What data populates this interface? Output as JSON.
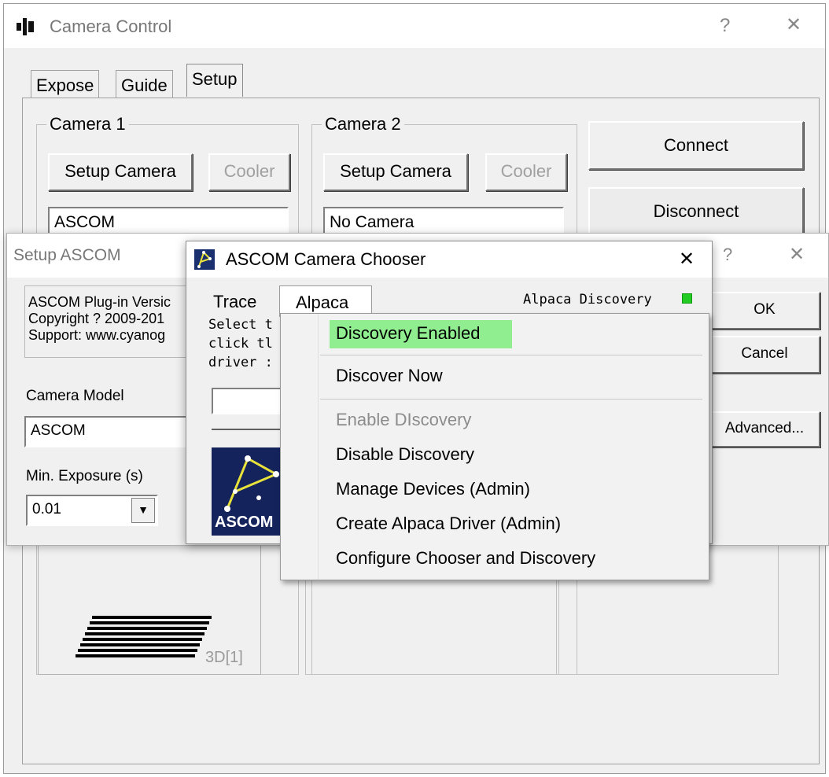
{
  "main_window": {
    "title": "Camera Control",
    "help": "?",
    "close": "✕",
    "tabs": [
      "Expose",
      "Guide",
      "Setup"
    ],
    "camera1": {
      "legend": "Camera 1",
      "setup_label": "Setup Camera",
      "cooler_label": "Cooler",
      "value": "ASCOM"
    },
    "camera2": {
      "legend": "Camera 2",
      "setup_label": "Setup Camera",
      "cooler_label": "Cooler",
      "value": "No Camera"
    },
    "connect_label": "Connect",
    "disconnect_label": "Disconnect",
    "preview_badge": "3D[1]"
  },
  "setup_ascom": {
    "title": "Setup ASCOM",
    "help": "?",
    "close": "✕",
    "info_lines": [
      "ASCOM Plug-in Versic",
      "Copyright ? 2009-201",
      "Support: www.cyanog"
    ],
    "camera_model_label": "Camera Model",
    "camera_model_value": "ASCOM",
    "min_exposure_label": "Min. Exposure (s)",
    "min_exposure_value": "0.01",
    "ok_label": "OK",
    "cancel_label": "Cancel",
    "advanced_label": "Advanced..."
  },
  "chooser": {
    "title": "ASCOM Camera Chooser",
    "close": "✕",
    "menu_trace": "Trace",
    "menu_alpaca": "Alpaca",
    "discovery_status": "Alpaca Discovery",
    "discovery_color": "#22cc22",
    "instructions": [
      "Select t",
      "click tl",
      "driver :"
    ],
    "logo_text": "ASCOM"
  },
  "alpaca_menu": {
    "items": [
      {
        "label": "Discovery Enabled",
        "state": "highlighted"
      },
      {
        "label": "Discover Now",
        "state": "normal"
      },
      {
        "label": "Enable DIscovery",
        "state": "disabled"
      },
      {
        "label": "Disable Discovery",
        "state": "normal"
      },
      {
        "label": "Manage Devices (Admin)",
        "state": "normal"
      },
      {
        "label": "Create Alpaca Driver (Admin)",
        "state": "normal"
      },
      {
        "label": "Configure Chooser and Discovery",
        "state": "normal"
      }
    ]
  }
}
